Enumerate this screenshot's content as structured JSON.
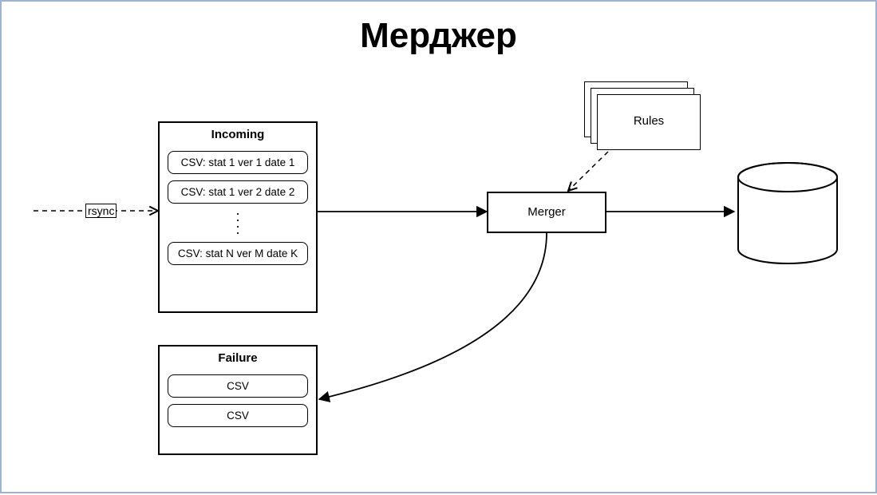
{
  "title": "Мерджер",
  "rsync_label": "rsync",
  "incoming": {
    "header": "Incoming",
    "rows": [
      "CSV: stat 1 ver 1 date 1",
      "CSV: stat 1 ver 2 date 2",
      "CSV: stat N ver M date K"
    ]
  },
  "failure": {
    "header": "Failure",
    "rows": [
      "CSV",
      "CSV"
    ]
  },
  "merger_label": "Merger",
  "rules_label": "Rules"
}
